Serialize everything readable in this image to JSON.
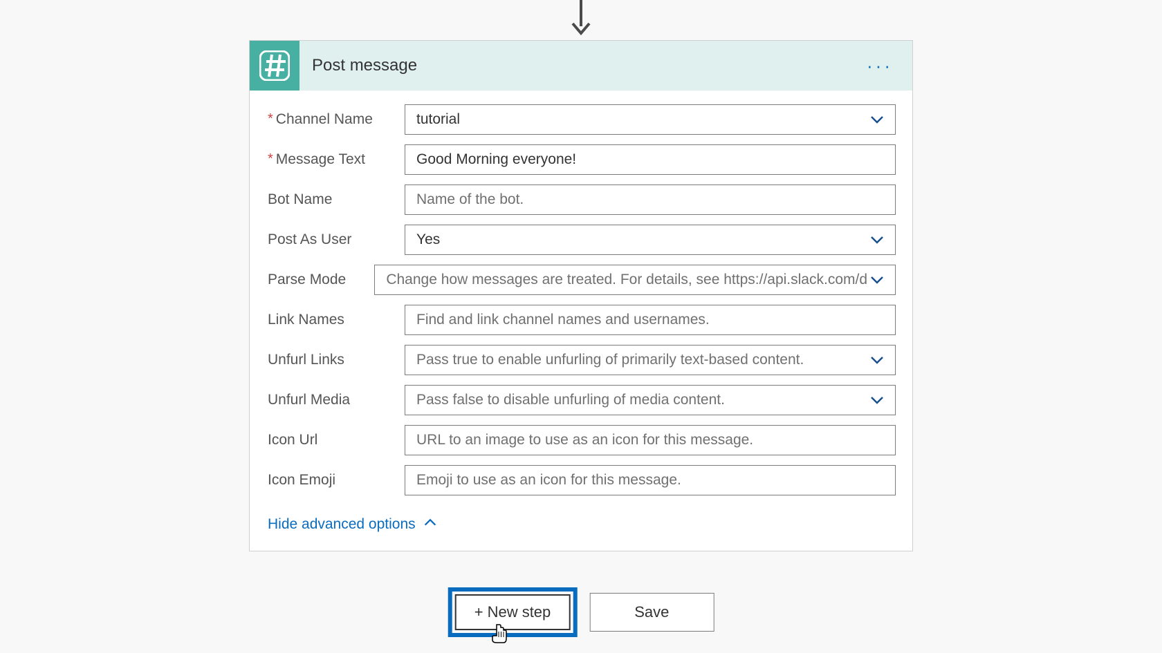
{
  "connector": {
    "title": "Post message",
    "icon_name": "slack-hash-icon"
  },
  "fields": {
    "channel_name": {
      "label": "Channel Name",
      "required": true,
      "value": "tutorial",
      "is_placeholder": false,
      "dropdown": true
    },
    "message_text": {
      "label": "Message Text",
      "required": true,
      "value": "Good Morning everyone!",
      "is_placeholder": false,
      "dropdown": false
    },
    "bot_name": {
      "label": "Bot Name",
      "required": false,
      "value": "Name of the bot.",
      "is_placeholder": true,
      "dropdown": false
    },
    "post_as_user": {
      "label": "Post As User",
      "required": false,
      "value": "Yes",
      "is_placeholder": false,
      "dropdown": true
    },
    "parse_mode": {
      "label": "Parse Mode",
      "required": false,
      "value": "Change how messages are treated. For details, see https://api.slack.com/d",
      "is_placeholder": true,
      "dropdown": true
    },
    "link_names": {
      "label": "Link Names",
      "required": false,
      "value": "Find and link channel names and usernames.",
      "is_placeholder": true,
      "dropdown": false
    },
    "unfurl_links": {
      "label": "Unfurl Links",
      "required": false,
      "value": "Pass true to enable unfurling of primarily text-based content.",
      "is_placeholder": true,
      "dropdown": true
    },
    "unfurl_media": {
      "label": "Unfurl Media",
      "required": false,
      "value": "Pass false to disable unfurling of media content.",
      "is_placeholder": true,
      "dropdown": true
    },
    "icon_url": {
      "label": "Icon Url",
      "required": false,
      "value": "URL to an image to use as an icon for this message.",
      "is_placeholder": true,
      "dropdown": false
    },
    "icon_emoji": {
      "label": "Icon Emoji",
      "required": false,
      "value": "Emoji to use as an icon for this message.",
      "is_placeholder": true,
      "dropdown": false
    }
  },
  "advanced_toggle": "Hide advanced options",
  "buttons": {
    "new_step": "New step",
    "save": "Save"
  },
  "colors": {
    "brand": "#48b0a3",
    "link": "#0a6cbf",
    "highlight": "#0a6cbf"
  }
}
